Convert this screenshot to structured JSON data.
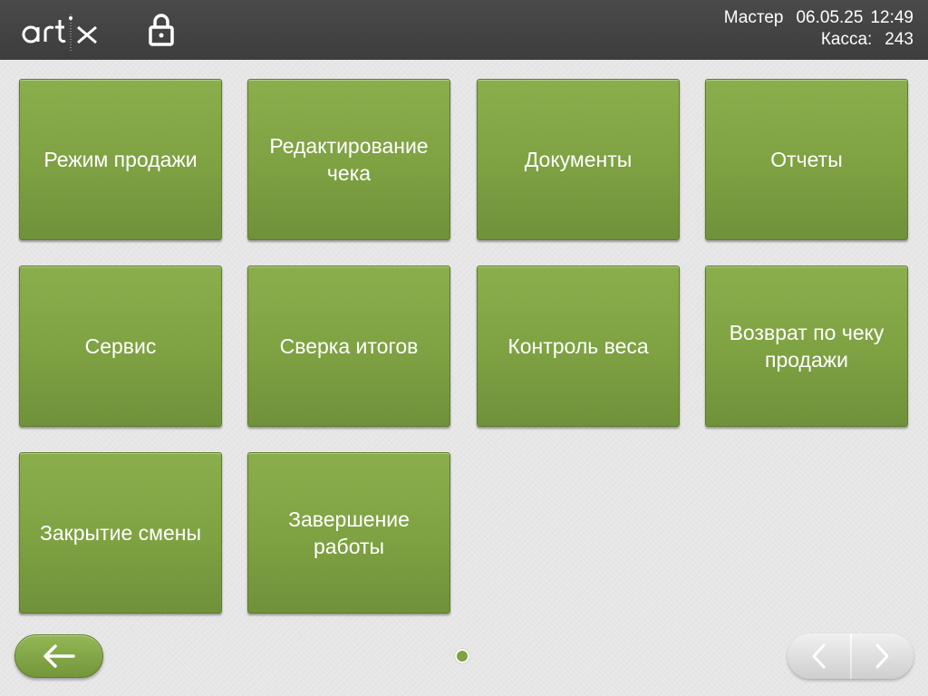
{
  "header": {
    "logo_text": "artix",
    "logo_icon": "artix-logo",
    "lock_icon": "lock-icon",
    "user": "Мастер",
    "date": "06.05.25",
    "time": "12:49",
    "register_label": "Касса:",
    "register_number": "243"
  },
  "menu": {
    "tiles": [
      {
        "label": "Режим продажи"
      },
      {
        "label": "Редактирование чека"
      },
      {
        "label": "Документы"
      },
      {
        "label": "Отчеты"
      },
      {
        "label": "Сервис"
      },
      {
        "label": "Сверка итогов"
      },
      {
        "label": "Контроль веса"
      },
      {
        "label": "Возврат по чеку продажи"
      },
      {
        "label": "Закрытие смены"
      },
      {
        "label": "Завершение работы"
      }
    ]
  },
  "footer": {
    "back_icon": "arrow-left-icon",
    "pager_prev_icon": "chevron-left-icon",
    "pager_next_icon": "chevron-right-icon",
    "current_page": 1,
    "total_pages": 1
  },
  "colors": {
    "tile_green": "#7ea142",
    "header_dark": "#434343",
    "background": "#e6e6e6"
  }
}
